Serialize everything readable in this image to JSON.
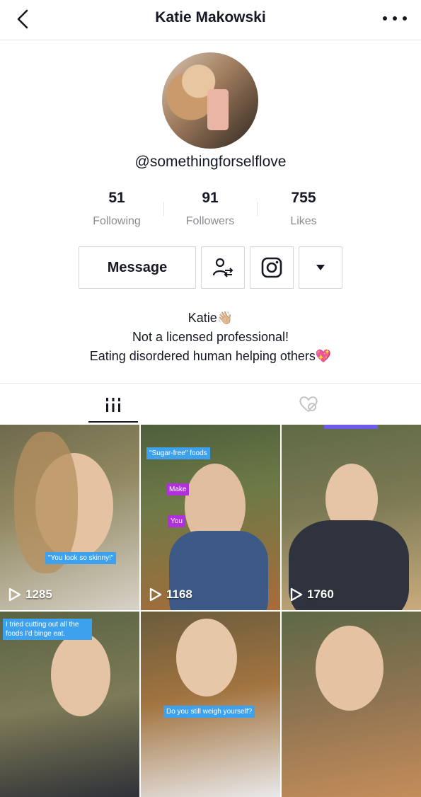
{
  "header": {
    "title": "Katie Makowski"
  },
  "profile": {
    "handle": "@somethingforselflove"
  },
  "stats": [
    {
      "value": "51",
      "label": "Following"
    },
    {
      "value": "91",
      "label": "Followers"
    },
    {
      "value": "755",
      "label": "Likes"
    }
  ],
  "actions": {
    "message_label": "Message"
  },
  "bio": {
    "line1": "Katie👋🏼",
    "line2": "Not a licensed professional!",
    "line3": "Eating disordered human helping others💖"
  },
  "videos": [
    {
      "views": "1285",
      "captions": [
        "\"You look so skinny!\""
      ]
    },
    {
      "views": "1168",
      "captions": [
        "\"Sugar-free\" foods",
        "Make",
        "You"
      ]
    },
    {
      "views": "1760",
      "captions": []
    },
    {
      "views": "",
      "captions": [
        "I tried cutting out all the foods I'd binge eat."
      ]
    },
    {
      "views": "",
      "captions": [
        "Do you still weigh yourself?"
      ]
    },
    {
      "views": "",
      "captions": []
    }
  ],
  "colors": {
    "caption_blue": "#3ea1ee",
    "caption_purple": "#b12fdf",
    "label_gray": "#8a8b91"
  }
}
